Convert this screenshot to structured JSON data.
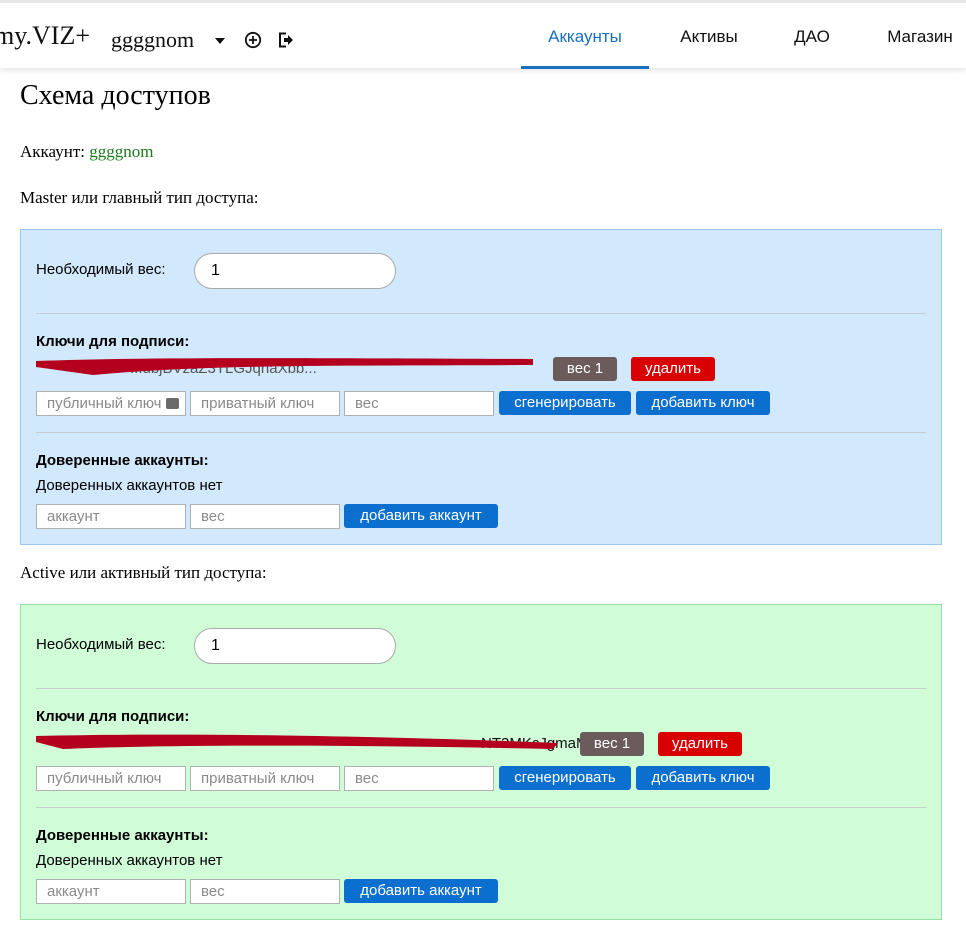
{
  "header": {
    "brand": "my.VIZ+",
    "username": "ggggnom",
    "nav": [
      {
        "label": "Аккаунты",
        "active": true
      },
      {
        "label": "Активы",
        "active": false
      },
      {
        "label": "ДАО",
        "active": false
      },
      {
        "label": "Магазин",
        "active": false
      }
    ],
    "accent_color": "#1a6fc1"
  },
  "page": {
    "title": "Схема доступов",
    "account_label": "Аккаунт:",
    "account_name": "ggggnom"
  },
  "master": {
    "section_title": "Master или главный тип доступа:",
    "required_weight_label": "Необходимый вес:",
    "required_weight_value": "1",
    "keys_title": "Ключи для подписи:",
    "key_visible_text": "...ubjBVzaZ3TLGJqnaXbb...",
    "key_weight_badge": "вес 1",
    "delete_label": "удалить",
    "public_key_placeholder": "публичный ключ",
    "private_key_placeholder": "приватный ключ",
    "weight_placeholder": "вес",
    "generate_label": "сгенерировать",
    "add_key_label": "добавить ключ",
    "trusted_title": "Доверенные аккаунты:",
    "trusted_empty": "Доверенных аккаунтов нет",
    "account_placeholder": "аккаунт",
    "trusted_weight_placeholder": "вес",
    "add_account_label": "добавить аккаунт",
    "panel_color": "#d2e8fc"
  },
  "active": {
    "section_title": "Active или активный тип доступа:",
    "required_weight_label": "Необходимый вес:",
    "required_weight_value": "1",
    "keys_title": "Ключи для подписи:",
    "key_visible_text": "NT3MKcJgmaM",
    "key_weight_badge": "вес 1",
    "delete_label": "удалить",
    "public_key_placeholder": "публичный ключ",
    "private_key_placeholder": "приватный ключ",
    "weight_placeholder": "вес",
    "generate_label": "сгенерировать",
    "add_key_label": "добавить ключ",
    "trusted_title": "Доверенные аккаунты:",
    "trusted_empty": "Доверенных аккаунтов нет",
    "account_placeholder": "аккаунт",
    "trusted_weight_placeholder": "вес",
    "add_account_label": "добавить аккаунт",
    "panel_color": "#d1fcd8"
  },
  "colors": {
    "button_blue": "#0a6fce",
    "badge_gray": "#6b5b5b",
    "delete_red": "#d80000",
    "account_green": "#1e7a1e",
    "redaction": "#b4001e"
  }
}
